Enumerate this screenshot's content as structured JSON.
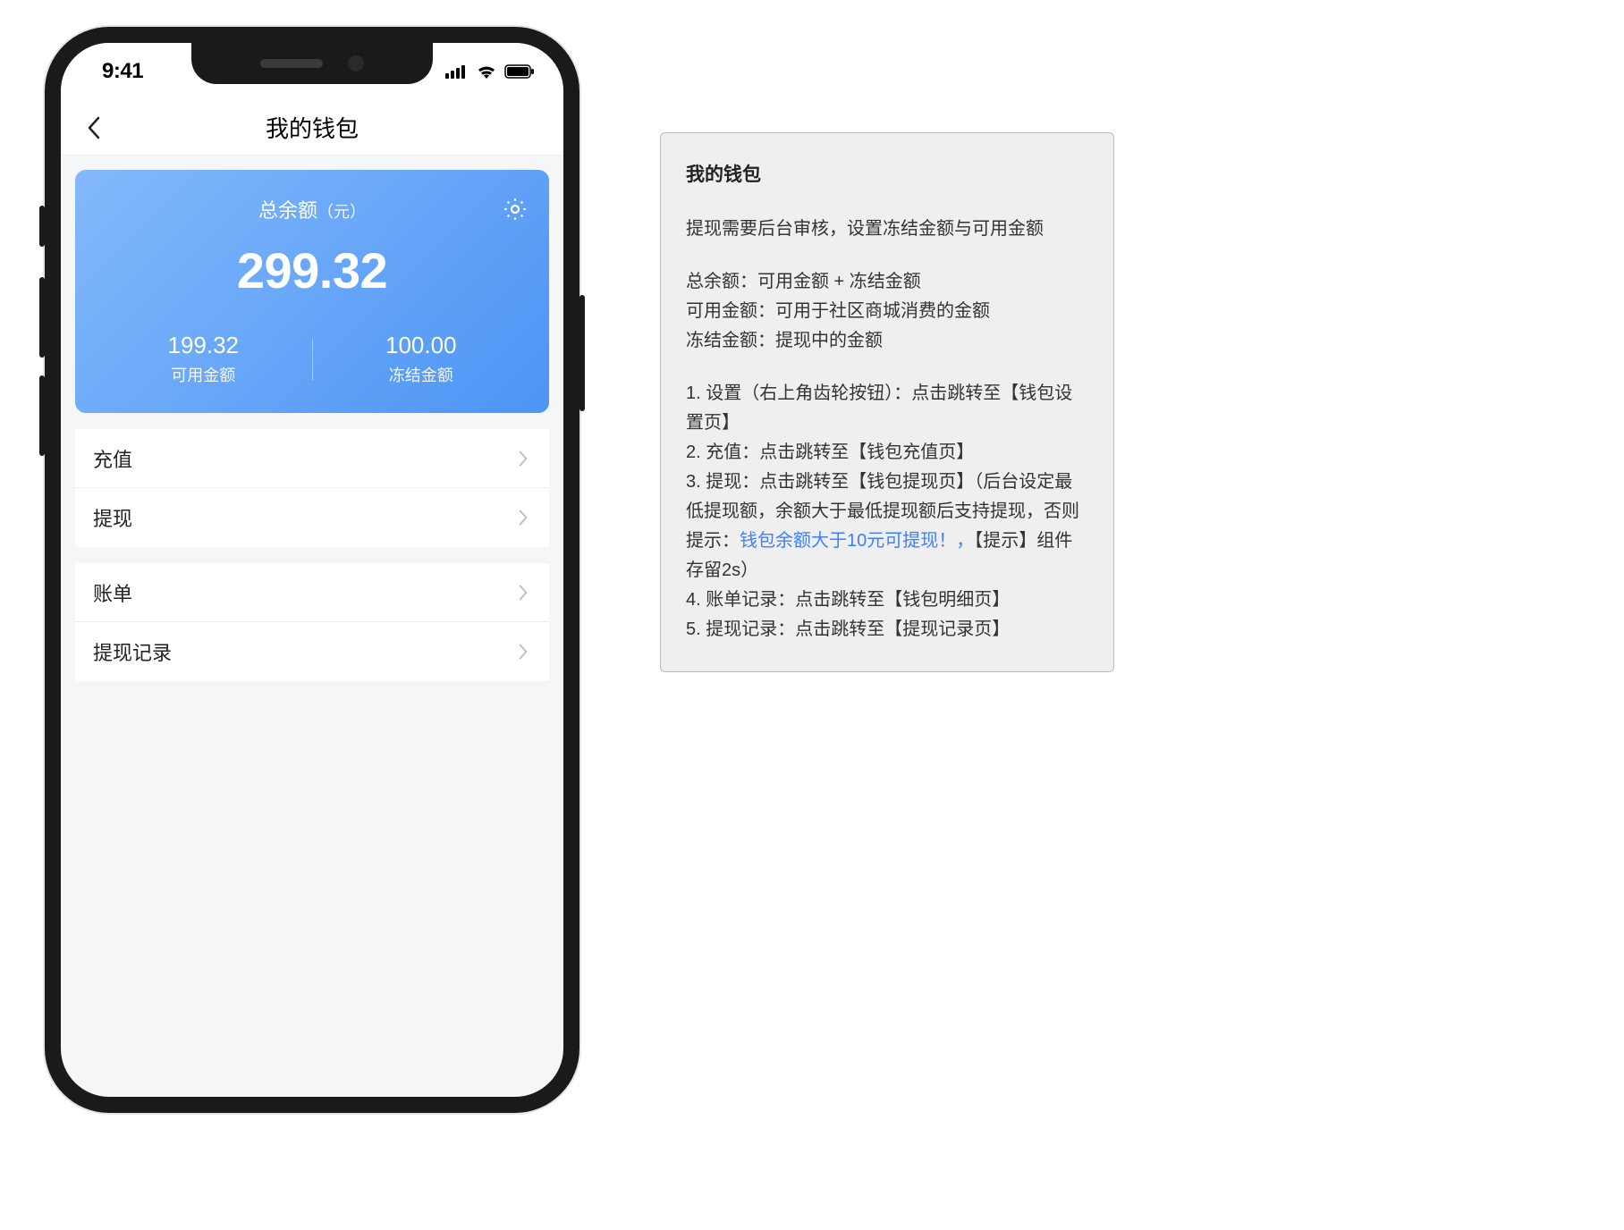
{
  "status_bar": {
    "time": "9:41"
  },
  "nav": {
    "title": "我的钱包"
  },
  "balance": {
    "label_main": "总余额",
    "label_unit": "（元）",
    "total": "299.32",
    "available_value": "199.32",
    "available_label": "可用金额",
    "frozen_value": "100.00",
    "frozen_label": "冻结金额"
  },
  "menu_group_1": [
    {
      "label": "充值"
    },
    {
      "label": "提现"
    }
  ],
  "menu_group_2": [
    {
      "label": "账单"
    },
    {
      "label": "提现记录"
    }
  ],
  "doc": {
    "title": "我的钱包",
    "intro": "提现需要后台审核，设置冻结金额与可用金额",
    "def1": "总余额：可用金额 + 冻结金额",
    "def2": "可用金额：可用于社区商城消费的金额",
    "def3": "冻结金额：提现中的金额",
    "step1": "1. 设置（右上角齿轮按钮）：点击跳转至【钱包设置页】",
    "step2": "2. 充值：点击跳转至【钱包充值页】",
    "step3a": "3. 提现：点击跳转至【钱包提现页】（后台设定最低提现额，余额大于最低提现额后支持提现，否则提示：",
    "step3_link": "钱包余额大于10元可提现！，",
    "step3b": "【提示】组件存留2s）",
    "step4": "4. 账单记录：点击跳转至【钱包明细页】",
    "step5": "5. 提现记录：点击跳转至【提现记录页】"
  }
}
